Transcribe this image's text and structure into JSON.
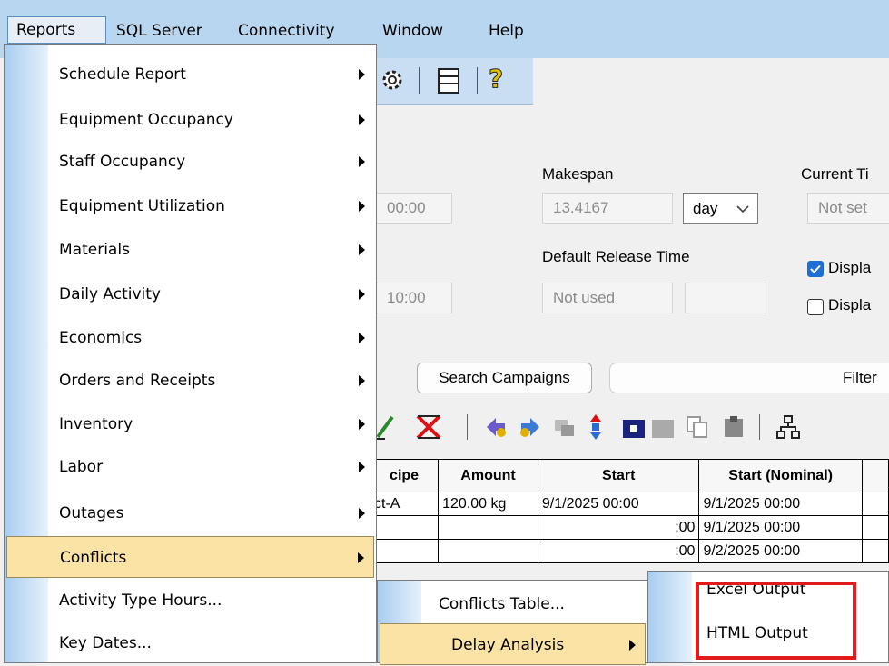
{
  "menubar": {
    "items": [
      "Reports",
      "SQL Server",
      "Connectivity",
      "Window",
      "Help"
    ]
  },
  "toolbar": {
    "icons": [
      "settings-icon",
      "database-icon",
      "help-icon"
    ]
  },
  "form": {
    "time1": "00:00",
    "time2": "10:00",
    "makespan_label": "Makespan",
    "makespan_value": "13.4167",
    "makespan_unit": "day",
    "current_time_label": "Current Ti",
    "current_time_value": "Not set",
    "default_release_label": "Default Release Time",
    "default_release_value": "Not used",
    "display1_label": "Displa",
    "display1_checked": true,
    "display2_label": "Displa",
    "display2_checked": false,
    "search_campaigns": "Search Campaigns",
    "filter_label": "Filter"
  },
  "grid": {
    "headers": [
      "cipe",
      "Amount",
      "Start",
      "Start (Nominal)"
    ],
    "rows": [
      [
        "ct-A",
        "120.00 kg",
        "9/1/2025 00:00",
        "9/1/2025 00:00"
      ],
      [
        "",
        "",
        ":00",
        "9/1/2025 00:00"
      ],
      [
        "",
        "",
        ":00",
        "9/2/2025 00:00"
      ]
    ]
  },
  "reports_menu": {
    "items": [
      {
        "label": "Schedule Report",
        "submenu": true
      },
      {
        "label": "Equipment Occupancy",
        "submenu": true
      },
      {
        "label": "Staff Occupancy",
        "submenu": true
      },
      {
        "label": "Equipment Utilization",
        "submenu": true
      },
      {
        "label": "Materials",
        "submenu": true
      },
      {
        "label": "Daily Activity",
        "submenu": true
      },
      {
        "label": "Economics",
        "submenu": true
      },
      {
        "label": "Orders and Receipts",
        "submenu": true
      },
      {
        "label": "Inventory",
        "submenu": true
      },
      {
        "label": "Labor",
        "submenu": true
      },
      {
        "label": "Outages",
        "submenu": true
      },
      {
        "label": "Conflicts",
        "submenu": true
      },
      {
        "label": "Activity Type Hours...",
        "submenu": false
      },
      {
        "label": "Key Dates...",
        "submenu": false
      }
    ]
  },
  "conflicts_menu": {
    "items": [
      {
        "label": "Conflicts Table...",
        "submenu": false
      },
      {
        "label": "Delay Analysis",
        "submenu": true
      }
    ]
  },
  "delay_menu": {
    "items": [
      {
        "label": "Excel Output"
      },
      {
        "label": "HTML Output"
      }
    ]
  },
  "colors": {
    "menubar": "#b9d6f0",
    "menu_highlight": "#fbe3a5",
    "annotation_box": "#e11b1b"
  }
}
